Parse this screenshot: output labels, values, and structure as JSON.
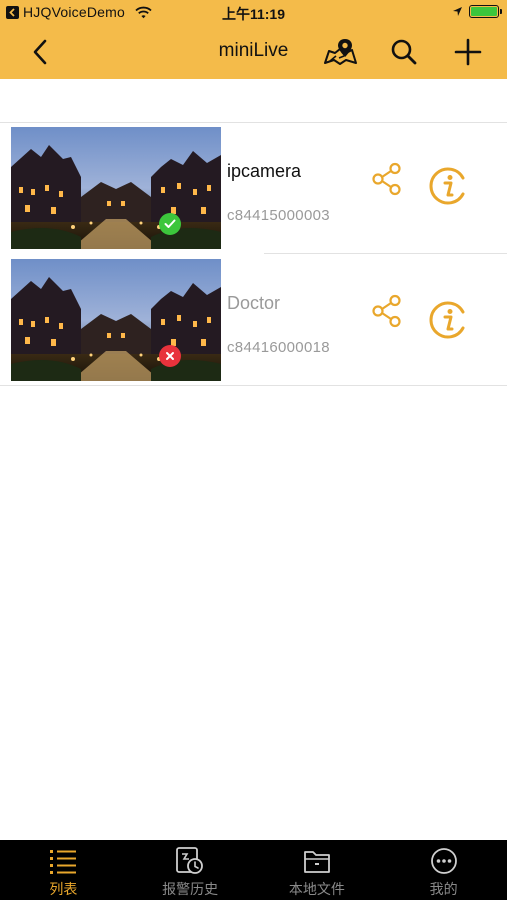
{
  "status_bar": {
    "carrier": "HJQVoiceDemo",
    "time": "上午11:19"
  },
  "nav": {
    "title": "miniLive"
  },
  "devices": [
    {
      "name": "ipcamera",
      "id": "c84415000003",
      "online": true,
      "status": "online"
    },
    {
      "name": "Doctor",
      "id": "c84416000018",
      "online": false,
      "status": "offline"
    }
  ],
  "tabs": [
    {
      "label": "列表",
      "icon": "list-icon",
      "active": true
    },
    {
      "label": "报警历史",
      "icon": "alarm-history-icon",
      "active": false
    },
    {
      "label": "本地文件",
      "icon": "folder-icon",
      "active": false
    },
    {
      "label": "我的",
      "icon": "more-icon",
      "active": false
    }
  ],
  "colors": {
    "accent": "#f4bb4a",
    "icon_orange": "#e9a72c",
    "online_green": "#3cc63c",
    "offline_red": "#e8323c",
    "battery_green": "#3cc63c"
  }
}
